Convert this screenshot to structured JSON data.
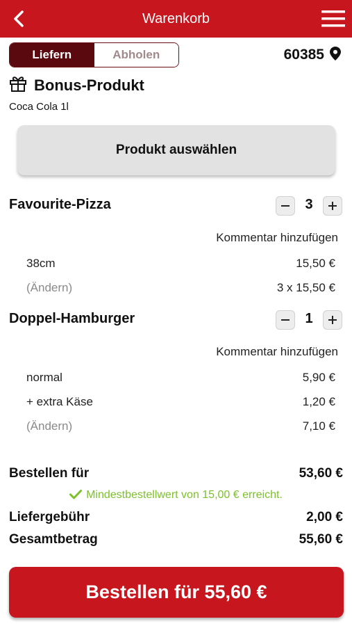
{
  "header": {
    "title": "Warenkorb",
    "back_icon": "chevron-left-icon",
    "menu_icon": "hamburger-menu-icon"
  },
  "delivery_toggle": {
    "options": [
      "Liefern",
      "Abholen"
    ],
    "selected": "Liefern"
  },
  "location": {
    "zip": "60385",
    "icon": "map-pin-icon"
  },
  "bonus": {
    "title": "Bonus-Produkt",
    "product": "Coca Cola 1l",
    "icon": "gift-icon",
    "button_label": "Produkt auswählen"
  },
  "items": [
    {
      "name": "Favourite-Pizza",
      "quantity": "3",
      "comment_label": "Kommentar hinzufügen",
      "lines": [
        {
          "label": "38cm",
          "value": "15,50 €"
        },
        {
          "label": "(Ändern)",
          "value": "3 x 15,50 €"
        }
      ]
    },
    {
      "name": "Doppel-Hamburger",
      "quantity": "1",
      "comment_label": "Kommentar hinzufügen",
      "lines": [
        {
          "label": "normal",
          "value": "5,90 €"
        },
        {
          "label": "+ extra Käse",
          "value": "1,20 €"
        },
        {
          "label": "(Ändern)",
          "value": "7,10 €"
        }
      ]
    }
  ],
  "summary": {
    "subtotal_label": "Bestellen für",
    "subtotal_value": "53,60 €",
    "minimum_message": "Mindestbestellwert von 15,00 € erreicht.",
    "fee_label": "Liefergebühr",
    "fee_value": "2,00 €",
    "total_label": "Gesamtbetrag",
    "total_value": "55,60 €"
  },
  "order_button": {
    "label": "Bestellen für 55,60 €"
  },
  "colors": {
    "brand_red": "#c8161e",
    "dark_red": "#5a0a0e",
    "success_green": "#7cc12a"
  }
}
